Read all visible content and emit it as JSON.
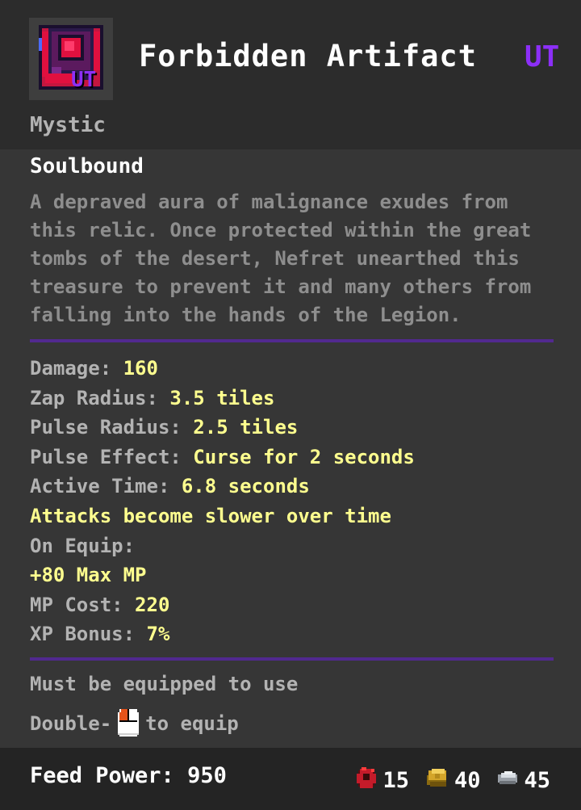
{
  "item": {
    "name": "Forbidden Artifact",
    "tier": "UT",
    "category": "Mystic",
    "soulbound": "Soulbound",
    "icon": "forbidden-artifact-icon",
    "icon_badge": "UT",
    "description_lines": [
      "A depraved aura of malignance exudes from",
      "this relic. Once protected within the great",
      "tombs of the desert, Nefret unearthed this",
      "treasure to prevent it and many others from",
      "falling into the hands of the Legion."
    ]
  },
  "stats": {
    "damage_label": "Damage: ",
    "damage_value": "160",
    "zap_label": "Zap Radius: ",
    "zap_value": "3.5 tiles",
    "pulse_radius_label": "Pulse Radius: ",
    "pulse_radius_value": "2.5 tiles",
    "pulse_effect_label": "Pulse Effect: ",
    "pulse_effect_value": "Curse for 2 seconds",
    "active_time_label": "Active Time: ",
    "active_time_value": "6.8 seconds",
    "attacks_note": "Attacks become slower over time",
    "on_equip_label": "On Equip:",
    "max_mp": "+80 Max MP",
    "mp_cost_label": "MP Cost: ",
    "mp_cost_value": "220",
    "xp_bonus_label": "XP Bonus: ",
    "xp_bonus_value": "7%"
  },
  "requirements": {
    "equip_required": "Must be equipped to use",
    "hint_prefix": "Double-",
    "hint_icon": "mouse-click-icon",
    "hint_suffix": " to equip"
  },
  "footer": {
    "feed_power_label": "Feed Power: ",
    "feed_power_value": "950",
    "materials": [
      {
        "icon": "red-essence-icon",
        "count": "15"
      },
      {
        "icon": "gold-essence-icon",
        "count": "40"
      },
      {
        "icon": "silver-essence-icon",
        "count": "45"
      }
    ]
  },
  "colors": {
    "tier": "#8c2ff7",
    "stat_value": "#ffff8f",
    "divider": "#51298f",
    "label": "#b3b3b3",
    "description": "#8e8e8e"
  }
}
